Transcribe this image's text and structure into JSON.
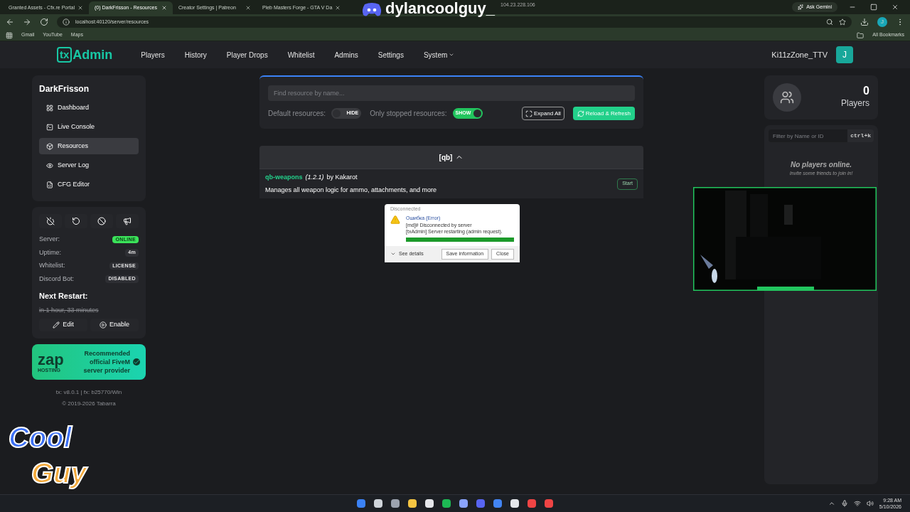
{
  "browser": {
    "tabs": [
      {
        "title": "Granted Assets - Cfx.re Portal",
        "selected": false
      },
      {
        "title": "(0) DarkFrisson - Resources",
        "selected": true
      },
      {
        "title": "Creator Settings | Patreon",
        "selected": false
      },
      {
        "title": "Pleb Masters Forge - GTA V Da",
        "selected": false
      }
    ],
    "ask_gemini": "Ask Gemini",
    "url": "localhost:40120/server/resources",
    "bookmarks": [
      "Gmail",
      "YouTube",
      "Maps"
    ],
    "all_bookmarks": "All Bookmarks",
    "profile": "J"
  },
  "header": {
    "logo_mark": "tx",
    "logo_text": "Admin",
    "nav": [
      {
        "label": "Players",
        "selected": false
      },
      {
        "label": "History",
        "selected": false
      },
      {
        "label": "Player Drops",
        "selected": false
      },
      {
        "label": "Whitelist",
        "selected": false
      },
      {
        "label": "Admins",
        "selected": false
      },
      {
        "label": "Settings",
        "selected": false
      },
      {
        "label": "System",
        "selected": false
      }
    ],
    "user": "Ki11zZone_TTV",
    "avatar": "J"
  },
  "sidebar": {
    "server_name": "DarkFrisson",
    "items": [
      {
        "label": "Dashboard",
        "selected": false
      },
      {
        "label": "Live Console",
        "selected": false
      },
      {
        "label": "Resources",
        "selected": true
      },
      {
        "label": "Server Log",
        "selected": false
      },
      {
        "label": "CFG Editor",
        "selected": false
      }
    ]
  },
  "status": {
    "rows": [
      {
        "label": "Server:",
        "value": "ONLINE",
        "kind": "success"
      },
      {
        "label": "Uptime:",
        "value": "4m",
        "kind": "neutral"
      },
      {
        "label": "Whitelist:",
        "value": "LICENSE",
        "kind": "neutral"
      },
      {
        "label": "Discord Bot:",
        "value": "DISABLED",
        "kind": "neutral"
      }
    ],
    "next_restart_title": "Next Restart:",
    "next_restart": "in 1 hour, 33 minutes",
    "next_restart_disabled": true,
    "buttons": [
      "Edit",
      "Enable"
    ]
  },
  "sponsor": {
    "logo": "zap",
    "logo_sub": "HOSTING",
    "lines": [
      "Recommended",
      "official FiveM",
      "server provider"
    ]
  },
  "footer": [
    "tx: v8.0.1 | fx: b25770/Win",
    "© 2019-2026 Tabarra"
  ],
  "resources": {
    "search_placeholder": "Find resource by name...",
    "toggles": [
      {
        "label": "Default resources:",
        "text": "HIDE",
        "on": false
      },
      {
        "label": "Only stopped resources:",
        "text": "SHOW",
        "on": true
      }
    ],
    "expand_all": "Expand All",
    "reload": "Reload & Refresh",
    "groups": [
      {
        "name": "[qb]",
        "expanded": true,
        "items": [
          {
            "name": "qb-weapons",
            "version": "(1.2.1)",
            "author": "by Kakarot",
            "description": "Manages all weapon logic for ammo, attachments, and more",
            "action": "Start"
          }
        ]
      }
    ]
  },
  "dialog": {
    "title": "Disconnected",
    "heading": "Ошибка (Error)",
    "lines": [
      "[md]# Disconnected by server",
      "[txAdmin] Server restarting (admin request)."
    ],
    "level": 1,
    "details": "See details",
    "buttons": [
      "Save information",
      "Close"
    ]
  },
  "players": {
    "count": "0",
    "label": "Players",
    "filter_placeholder": "Filter by Name or ID",
    "shortcut": "ctrl+k",
    "empty_title": "No players online.",
    "empty_subtitle": "Invite some friends to join in!"
  },
  "overlay": {
    "username": "dylancoolguy_",
    "ip": "104.23.228.106",
    "logo_lines": [
      "Cool",
      "Guy"
    ]
  },
  "taskbar": {
    "time": "9:28 AM",
    "date": "5/10/2026"
  }
}
